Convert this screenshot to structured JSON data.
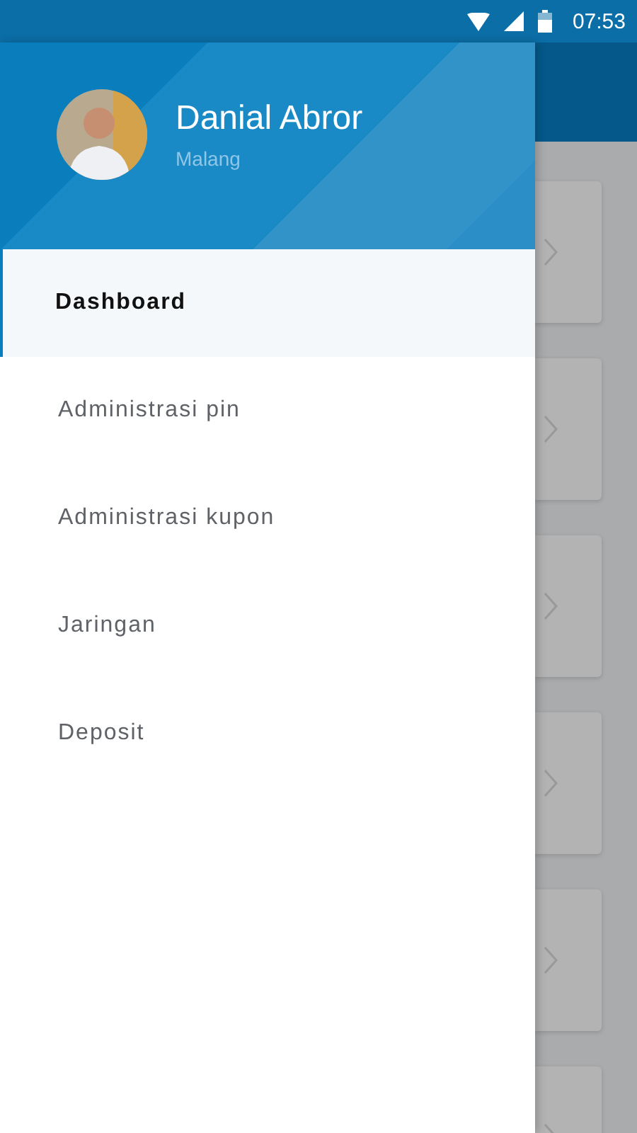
{
  "status_bar": {
    "time": "07:53"
  },
  "profile": {
    "name": "Danial Abror",
    "location": "Malang"
  },
  "menu": [
    {
      "label": "Dashboard",
      "selected": true
    },
    {
      "label": "Administrasi pin",
      "selected": false
    },
    {
      "label": "Administrasi kupon",
      "selected": false
    },
    {
      "label": "Jaringan",
      "selected": false
    },
    {
      "label": "Deposit",
      "selected": false
    }
  ]
}
